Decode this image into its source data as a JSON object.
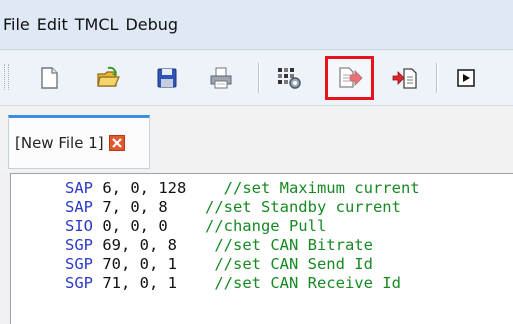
{
  "menu": {
    "items": [
      "File",
      "Edit",
      "TMCL",
      "Debug"
    ]
  },
  "toolbar": {
    "buttons": [
      {
        "name": "new-file",
        "icon": "new-file-icon"
      },
      {
        "name": "open-file",
        "icon": "open-folder-icon"
      },
      {
        "name": "save-file",
        "icon": "floppy-disk-icon"
      },
      {
        "name": "print",
        "icon": "printer-icon"
      },
      {
        "name": "assemble",
        "icon": "assemble-icon"
      },
      {
        "name": "download",
        "icon": "download-to-module-icon",
        "highlighted": true
      },
      {
        "name": "stop",
        "icon": "stop-download-icon"
      },
      {
        "name": "run",
        "icon": "run-icon"
      }
    ],
    "highlight_color": "#e8121c"
  },
  "tabs": [
    {
      "label": "[New File 1]",
      "active": true
    }
  ],
  "editor": {
    "lines": [
      {
        "cmd": "SAP",
        "args": " 6, 0, 128",
        "pad": "    ",
        "comment": "//set Maximum current"
      },
      {
        "cmd": "SAP",
        "args": " 7, 0, 8",
        "pad": "    ",
        "comment": "//set Standby current"
      },
      {
        "cmd": "SIO",
        "args": " 0, 0, 0",
        "pad": "    ",
        "comment": "//change Pull"
      },
      {
        "cmd": "SGP",
        "args": " 69, 0, 8",
        "pad": "    ",
        "comment": "//set CAN Bitrate"
      },
      {
        "cmd": "SGP",
        "args": " 70, 0, 1",
        "pad": "    ",
        "comment": "//set CAN Send Id"
      },
      {
        "cmd": "SGP",
        "args": " 71, 0, 1",
        "pad": "    ",
        "comment": "//set CAN Receive Id"
      }
    ],
    "colors": {
      "command": "#2b39c7",
      "comment": "#178a22"
    }
  }
}
